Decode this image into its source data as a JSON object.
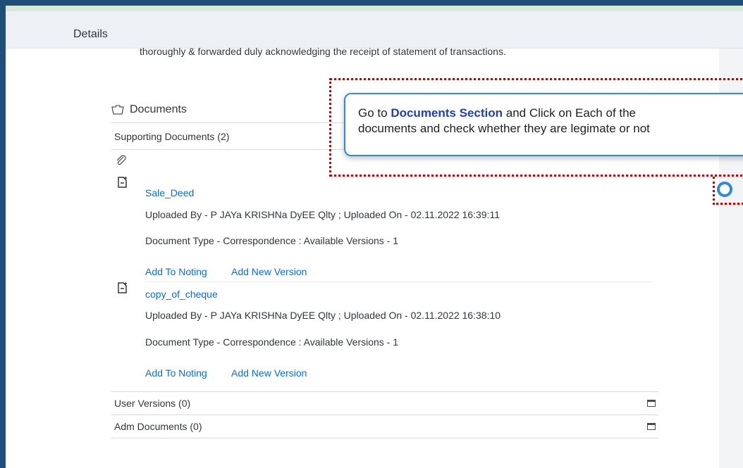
{
  "header": {
    "title": "Details"
  },
  "intro_text": "thoroughly & forwarded duly acknowledging the receipt of statement of transactions.",
  "documents": {
    "title": "Documents",
    "supporting_label": "Supporting Documents (2)",
    "items": [
      {
        "name": "Sale_Deed",
        "uploaded": "Uploaded By - P JAYa KRISHNa DyEE Qlty ; Uploaded On - 02.11.2022 16:39:11",
        "doc_type": "Document Type - Correspondence : Available Versions - 1",
        "action_noting": "Add To Noting",
        "action_version": "Add New Version"
      },
      {
        "name": "copy_of_cheque",
        "uploaded": "Uploaded By - P JAYa KRISHNa DyEE Qlty ; Uploaded On - 02.11.2022 16:38:10",
        "doc_type": "Document Type - Correspondence : Available Versions - 1",
        "action_noting": "Add To Noting",
        "action_version": "Add New Version"
      }
    ],
    "user_versions_label": "User Versions (0)",
    "adm_documents_label": "Adm Documents (0)"
  },
  "tooltip": {
    "prefix": "Go to ",
    "highlight": "Documents Section",
    "line1_suffix": " and Click on Each of the",
    "line2": "documents and check whether they are legimate or not"
  },
  "colors": {
    "link": "#0a6ed1",
    "frame": "#1f4e79",
    "highlight": "#1f3fb8",
    "annotation": "#c00000"
  }
}
